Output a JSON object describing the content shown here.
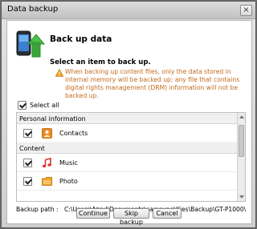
{
  "window": {
    "title": "Data backup",
    "close_symbol": "×"
  },
  "header": {
    "icon": "phone-backup-arrow-icon",
    "title": "Back up data",
    "prompt": "Select an item to back up.",
    "warning_icon": "warning-triangle-icon",
    "warning": "When backing up content files, only the data stored in internal memory will be backed up; any file that contains digital rights management (DRM) information will not be backed up."
  },
  "select_all": {
    "label": "Select all",
    "checked": true
  },
  "groups": [
    {
      "title": "Personal information",
      "items": [
        {
          "label": "Contacts",
          "icon": "contacts-icon",
          "checked": true
        }
      ]
    },
    {
      "title": "Content",
      "items": [
        {
          "label": "Music",
          "icon": "music-note-icon",
          "checked": true
        },
        {
          "label": "Photo",
          "icon": "photo-folder-icon",
          "checked": true
        }
      ]
    }
  ],
  "backup_path": {
    "label": "Backup path :",
    "value": "C:\\Users\\Azrul\\Documents\\samsung\\Kies\\Backup\\GT-P1000\\"
  },
  "buttons": {
    "continue": "Continue",
    "skip": "Skip backup",
    "cancel": "Cancel"
  },
  "colors": {
    "warning_text": "#c56a1a",
    "accent_green": "#3aa63a",
    "contacts_orange": "#e88a1f",
    "music_red": "#d9332c"
  }
}
